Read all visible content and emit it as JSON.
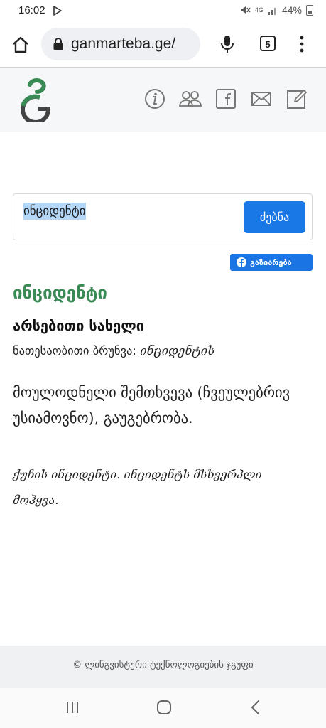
{
  "status_bar": {
    "time": "16:02",
    "network": "4G",
    "battery": "44%"
  },
  "browser": {
    "url": "ganmarteba.ge/",
    "tab_count": "5"
  },
  "search": {
    "value": "ინციდენტი",
    "button_label": "ძებნა"
  },
  "share": {
    "label": "გაზიარება"
  },
  "entry": {
    "word": "ინციდენტი",
    "part_of_speech": "არსებითი სახელი",
    "genitive_label": "ნათესაობითი ბრუნვა:",
    "genitive_form": "ინციდენტის",
    "definition": "მოულოდნელი შემთხვევა (ჩვეულებრივ უსიამოვნო), გაუგებრობა.",
    "examples": "ქუჩის ინციდენტი. ინციდენტს მსხვერპლი მოჰყვა."
  },
  "footer": {
    "copyright": "© ლინგვისტური ტექნოლოგიების ჯგუფი"
  },
  "colors": {
    "accent_green": "#3a8a55",
    "button_blue": "#1a78e6",
    "facebook_blue": "#1b74e4"
  }
}
